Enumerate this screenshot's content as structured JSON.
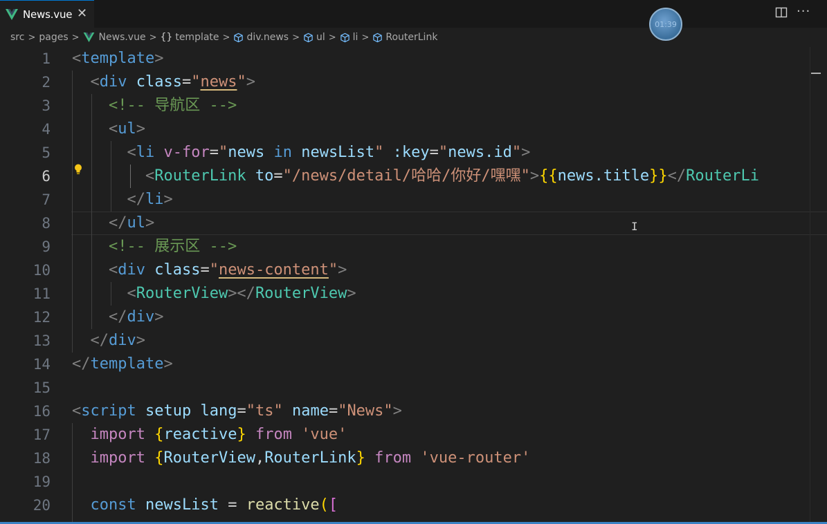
{
  "tab": {
    "label": "News.vue",
    "close": "✕"
  },
  "timer": "01:39",
  "actions": {
    "more": "···"
  },
  "breadcrumb": {
    "items": [
      "src",
      "pages",
      "News.vue",
      "template",
      "div.news",
      "ul",
      "li",
      "RouterLink"
    ],
    "separator": ">",
    "braces": "{}"
  },
  "editor": {
    "active_line": 6,
    "line_numbers": [
      "1",
      "2",
      "3",
      "4",
      "5",
      "6",
      "7",
      "8",
      "9",
      "10",
      "11",
      "12",
      "13",
      "14",
      "15",
      "16",
      "17",
      "18",
      "19",
      "20"
    ],
    "cursor": "I"
  },
  "tokens": {
    "template": "template",
    "div": "div",
    "class": "class",
    "news": "news",
    "comment_nav": "<!-- 导航区 -->",
    "ul": "ul",
    "li": "li",
    "v_for": "v-for",
    "for_expr_news": "news",
    "for_expr_in": "in",
    "for_expr_list": "newsList",
    "key": ":key",
    "key_expr": "news.id",
    "routerlink": "RouterLink",
    "to": "to",
    "to_value": "/news/detail/哈哈/你好/嘿嘿",
    "mustache_open": "{{",
    "news_title_obj": "news",
    "news_title_prop": ".title",
    "mustache_close": "}}",
    "routerlink_close_partial": "RouterLi",
    "comment_show": "<!-- 展示区 -->",
    "news_content": "news-content",
    "routerview": "RouterView",
    "script": "script",
    "setup": "setup",
    "lang": "lang",
    "ts": "ts",
    "name": "name",
    "News": "News",
    "import": "import",
    "reactive": "reactive",
    "from": "from",
    "vue_str": "'vue'",
    "RouterView": "RouterView",
    "RouterLink": "RouterLink",
    "vue_router_str": "'vue-router'",
    "const": "const",
    "newsList": "newsList",
    "eq": "=",
    "reactive_call": "reactive",
    "paren": "(",
    "bracket": "["
  },
  "colors": {
    "tag": "#569cd6",
    "component": "#4ec9b0",
    "attribute": "#9cdcfe",
    "string": "#ce9178",
    "comment": "#6a9955",
    "keyword": "#c586c0"
  }
}
